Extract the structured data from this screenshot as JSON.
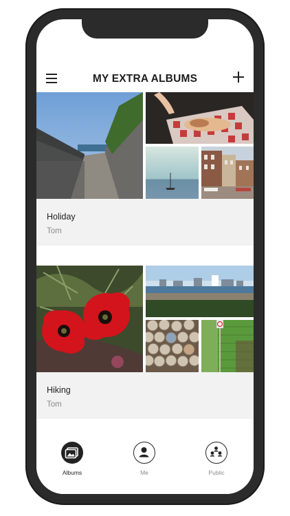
{
  "header": {
    "title": "MY EXTRA ALBUMS"
  },
  "albums": [
    {
      "name": "Holiday",
      "owner": "Tom"
    },
    {
      "name": "Hiking",
      "owner": "Tom"
    }
  ],
  "tabs": [
    {
      "label": "Albums",
      "icon": "albums-icon",
      "active": true
    },
    {
      "label": "Me",
      "icon": "person-icon",
      "active": false
    },
    {
      "label": "Public",
      "icon": "people-group-icon",
      "active": false
    }
  ],
  "colors": {
    "phone_frame": "#2b2b2b",
    "caption_bg": "#f2f2f2",
    "active_tab": "#222222",
    "inactive_tab": "#8a8a8a"
  }
}
